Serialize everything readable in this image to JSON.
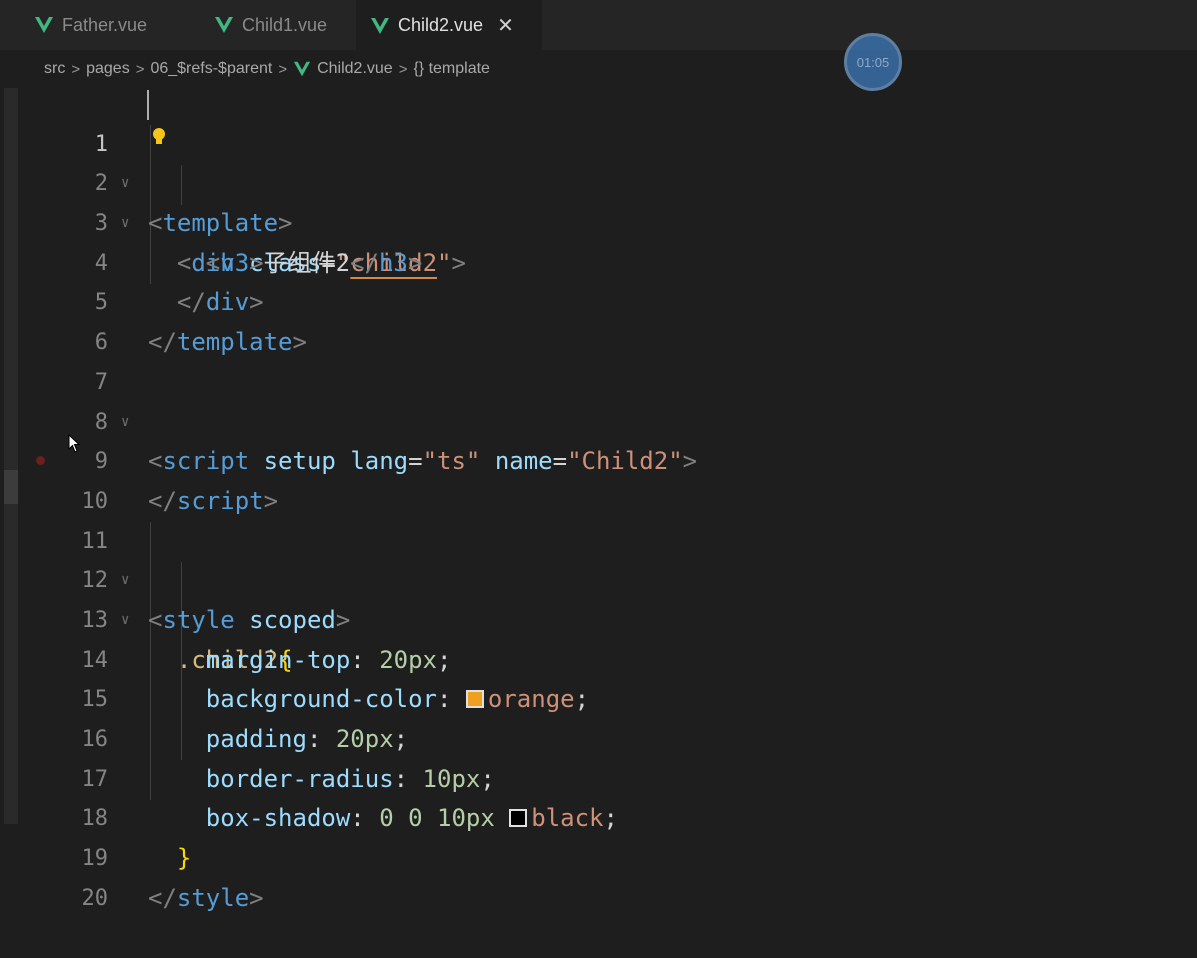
{
  "tabs": [
    {
      "label": "Father.vue",
      "active": false
    },
    {
      "label": "Child1.vue",
      "active": false
    },
    {
      "label": "Child2.vue",
      "active": true,
      "close": "✕"
    }
  ],
  "breadcrumb": {
    "items": [
      "src",
      "pages",
      "06_$refs-$parent",
      "Child2.vue",
      "{} template"
    ]
  },
  "timer": "01:05",
  "colors": {
    "vue_green": "#41b883",
    "orange_swatch": "#f0a020",
    "black_swatch": "#000000"
  },
  "code": {
    "line_numbers": [
      "1",
      "2",
      "3",
      "4",
      "5",
      "6",
      "7",
      "8",
      "9",
      "10",
      "11",
      "12",
      "13",
      "14",
      "15",
      "16",
      "17",
      "18",
      "19",
      "20"
    ],
    "l1": {
      "open": "<",
      "tag": "template",
      "close": ">"
    },
    "l2": {
      "open": "<",
      "tag": "div",
      "attr": "class",
      "eq": "=",
      "q1": "\"",
      "val": "child2",
      "q2": "\"",
      "close": ">"
    },
    "l3": {
      "open": "<",
      "tag": "h3",
      "close": ">",
      "text": "子组件2",
      "end_open": "</",
      "end_tag": "h3",
      "end_close": ">"
    },
    "l4": {
      "open": "</",
      "tag": "div",
      "close": ">"
    },
    "l5": {
      "open": "</",
      "tag": "template",
      "close": ">"
    },
    "l7": {
      "open": "<",
      "tag": "script",
      "attr1": "setup",
      "attr2": "lang",
      "eq1": "=",
      "val1": "\"ts\"",
      "attr3": "name",
      "eq2": "=",
      "val2": "\"Child2\"",
      "close": ">"
    },
    "l9": {
      "open": "</",
      "tag": "script",
      "close": ">"
    },
    "l11": {
      "open": "<",
      "tag": "style",
      "attr": "scoped",
      "close": ">"
    },
    "l12": {
      "selector": ".child2",
      "brace": "{"
    },
    "l13": {
      "prop": "margin-top",
      "colon": ": ",
      "value": "20px",
      "semi": ";"
    },
    "l14": {
      "prop": "background-color",
      "colon": ": ",
      "value": "orange",
      "semi": ";"
    },
    "l15": {
      "prop": "padding",
      "colon": ": ",
      "value": "20px",
      "semi": ";"
    },
    "l16": {
      "prop": "border-radius",
      "colon": ": ",
      "value": "10px",
      "semi": ";"
    },
    "l17": {
      "prop": "box-shadow",
      "colon": ": ",
      "value": "0 0 10px",
      "value2": "black",
      "semi": ";"
    },
    "l18": {
      "brace": "}"
    },
    "l19": {
      "open": "</",
      "tag": "style",
      "close": ">"
    }
  }
}
